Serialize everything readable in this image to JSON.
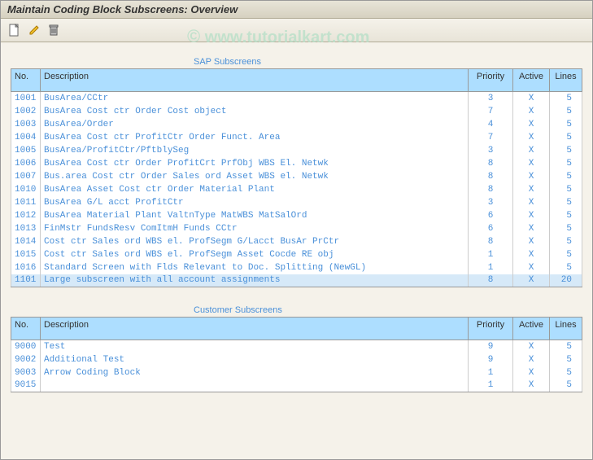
{
  "window_title": "Maintain Coding Block Subscreens: Overview",
  "watermark": "www.tutorialkart.com",
  "toolbar": {
    "new_doc": "new-document",
    "edit": "edit",
    "delete": "delete"
  },
  "sections": {
    "sap": {
      "title": "SAP Subscreens",
      "columns": {
        "no": "No.",
        "desc": "Description",
        "priority": "Priority",
        "active": "Active",
        "lines": "Lines"
      },
      "rows": [
        {
          "no": "1001",
          "desc": "BusArea/CCtr",
          "priority": "3",
          "active": "X",
          "lines": "5"
        },
        {
          "no": "1002",
          "desc": "BusArea  Cost ctr   Order    Cost object",
          "priority": "7",
          "active": "X",
          "lines": "5"
        },
        {
          "no": "1003",
          "desc": "BusArea/Order",
          "priority": "4",
          "active": "X",
          "lines": "5"
        },
        {
          "no": "1004",
          "desc": "BusArea  Cost ctr   ProfitCtr  Order  Funct. Area",
          "priority": "7",
          "active": "X",
          "lines": "5"
        },
        {
          "no": "1005",
          "desc": "BusArea/ProfitCtr/PftblySeg",
          "priority": "3",
          "active": "X",
          "lines": "5"
        },
        {
          "no": "1006",
          "desc": "BusArea  Cost ctr   Order     ProfitCrt PrfObj WBS El. Netwk",
          "priority": "8",
          "active": "X",
          "lines": "5"
        },
        {
          "no": "1007",
          "desc": "Bus.area Cost ctr   Order     Sales ord Asset  WBS el. Netwk",
          "priority": "8",
          "active": "X",
          "lines": "5"
        },
        {
          "no": "1010",
          "desc": "BusArea  Asset      Cost ctr Order   Material Plant",
          "priority": "8",
          "active": "X",
          "lines": "5"
        },
        {
          "no": "1011",
          "desc": "BusArea  G/L acct   ProfitCtr",
          "priority": "3",
          "active": "X",
          "lines": "5"
        },
        {
          "no": "1012",
          "desc": "BusArea  Material   Plant     ValtnType MatWBS MatSalOrd",
          "priority": "6",
          "active": "X",
          "lines": "5"
        },
        {
          "no": "1013",
          "desc": "FinMstr  FundsResv  ComItmH  Funds     CCtr",
          "priority": "6",
          "active": "X",
          "lines": "5"
        },
        {
          "no": "1014",
          "desc": "Cost ctr Sales ord  WBS el.  ProfSegm  G/Lacct BusAr  PrCtr",
          "priority": "8",
          "active": "X",
          "lines": "5"
        },
        {
          "no": "1015",
          "desc": "Cost ctr Sales ord  WBS el.  ProfSegm  Asset  Cocde RE obj",
          "priority": "1",
          "active": "X",
          "lines": "5"
        },
        {
          "no": "1016",
          "desc": "Standard Screen with Flds Relevant to Doc. Splitting (NewGL)",
          "priority": "1",
          "active": "X",
          "lines": "5"
        },
        {
          "no": "1101",
          "desc": "Large subscreen with all account assignments",
          "priority": "8",
          "active": "X",
          "lines": "20",
          "selected": true
        }
      ]
    },
    "customer": {
      "title": "Customer Subscreens",
      "columns": {
        "no": "No.",
        "desc": "Description",
        "priority": "Priority",
        "active": "Active",
        "lines": "Lines"
      },
      "rows": [
        {
          "no": "9000",
          "desc": "Test",
          "priority": "9",
          "active": "X",
          "lines": "5"
        },
        {
          "no": "9002",
          "desc": "Additional Test",
          "priority": "9",
          "active": "X",
          "lines": "5"
        },
        {
          "no": "9003",
          "desc": "Arrow Coding Block",
          "priority": "1",
          "active": "X",
          "lines": "5"
        },
        {
          "no": "9015",
          "desc": "",
          "priority": "1",
          "active": "X",
          "lines": "5"
        }
      ]
    }
  }
}
